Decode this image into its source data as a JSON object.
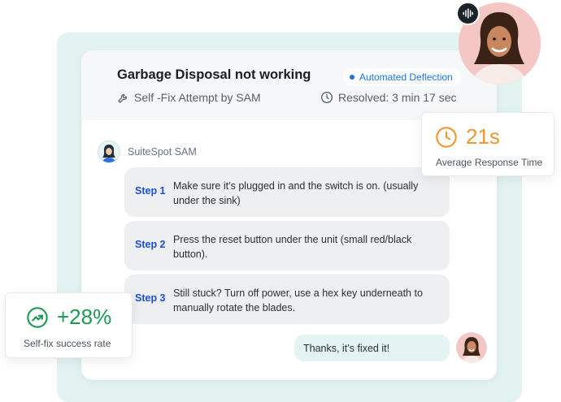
{
  "ticket": {
    "title": "Garbage Disposal not working",
    "tag": "Automated Deflection",
    "attempt": "Self -Fix Attempt by SAM",
    "resolved": "Resolved: 3 min 17 sec"
  },
  "assistant": {
    "name": "SuiteSpot SAM"
  },
  "steps": [
    {
      "label": "Step 1",
      "text": "Make sure it’s plugged in and the switch is on. (usually under the sink)"
    },
    {
      "label": "Step 2",
      "text": "Press the reset button under the unit (small red/black button)."
    },
    {
      "label": "Step 3",
      "text": "Still stuck? Turn off power, use a hex key underneath to manually rotate the blades."
    }
  ],
  "reply": {
    "text": "Thanks, it’s fixed it!"
  },
  "stats": {
    "response": {
      "value": "21s",
      "label": "Average Response Time",
      "color": "#f2962e"
    },
    "selffix": {
      "value": "+28%",
      "label": "Self-fix success rate",
      "color": "#1c9a55"
    }
  },
  "colors": {
    "backdrop": "#e2f3f1",
    "accent_blue": "#1a73e8",
    "step_label": "#1a4fd6"
  },
  "icons": {
    "tag": "dot-icon",
    "attempt": "wrench-icon",
    "resolved": "clock-icon",
    "response": "clock-icon",
    "selffix": "trending-up-icon",
    "voice": "voice-waveform-icon"
  }
}
